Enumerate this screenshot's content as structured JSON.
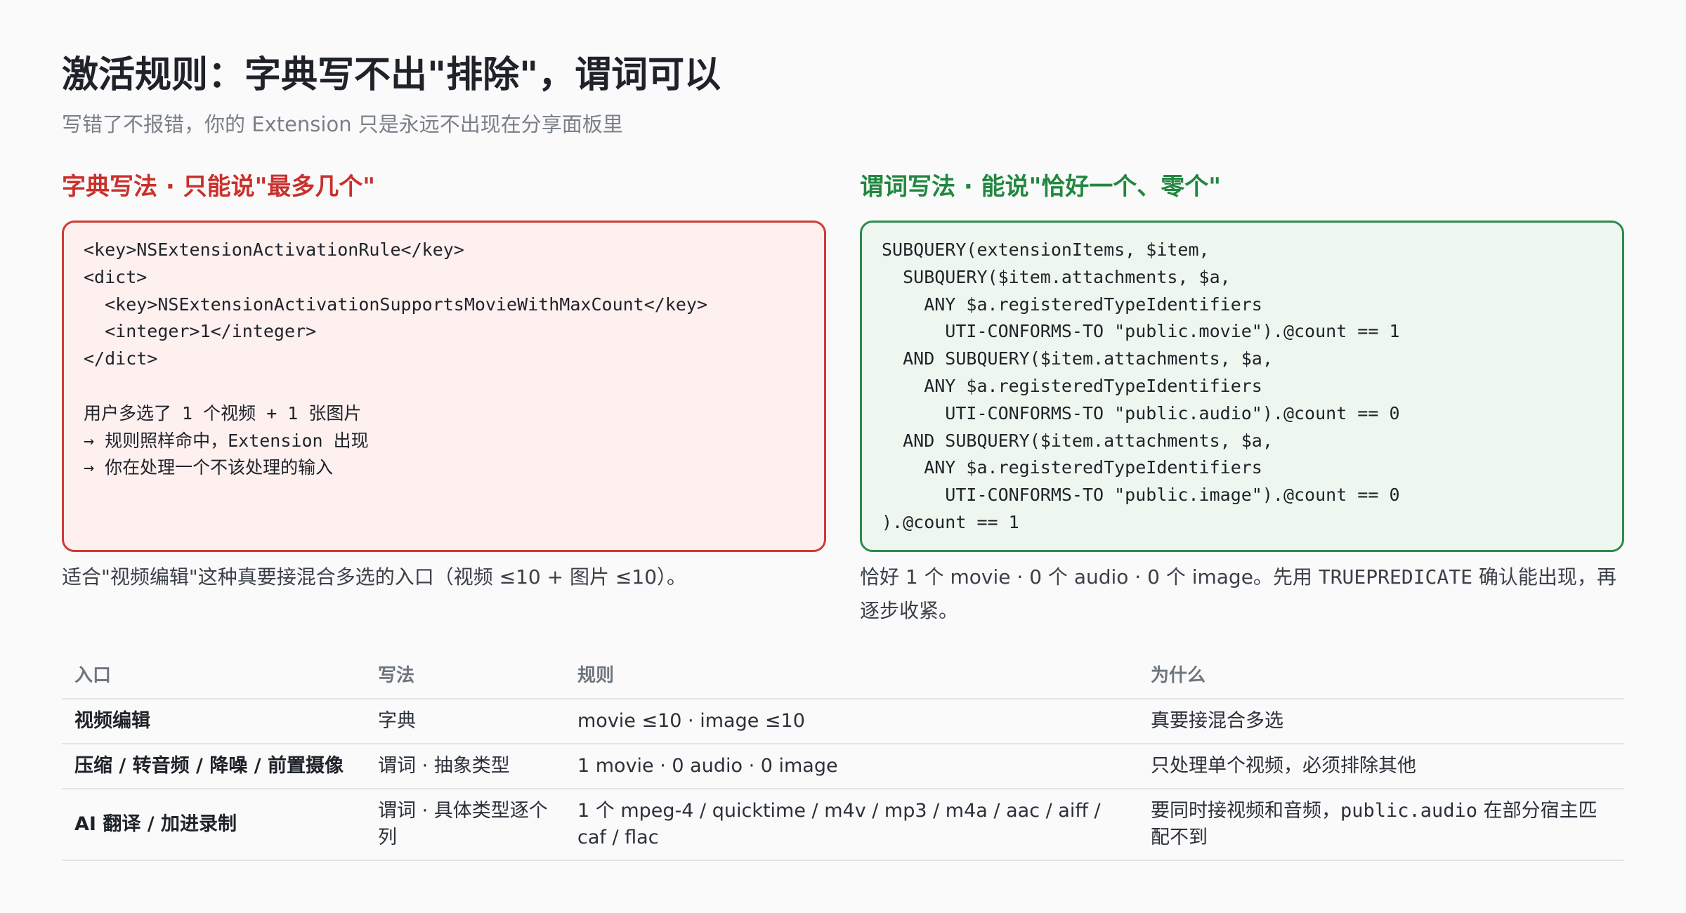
{
  "header": {
    "title": "激活规则：字典写不出\"排除\"，谓词可以",
    "subtitle": "写错了不报错，你的 Extension 只是永远不出现在分享面板里"
  },
  "dict_panel": {
    "heading": "字典写法 · 只能说\"最多几个\"",
    "code_lines": [
      "<key>NSExtensionActivationRule</key>",
      "<dict>",
      "  <key>NSExtensionActivationSupportsMovieWithMaxCount</key>",
      "  <integer>1</integer>",
      "</dict>",
      "",
      "用户多选了 1 个视频 + 1 张图片",
      "→ 规则照样命中，Extension 出现",
      "→ 你在处理一个不该处理的输入"
    ],
    "note": "适合\"视频编辑\"这种真要接混合多选的入口（视频 ≤10 + 图片 ≤10）。"
  },
  "predicate_panel": {
    "heading": "谓词写法 · 能说\"恰好一个、零个\"",
    "code_lines": [
      "SUBQUERY(extensionItems, $item,",
      "  SUBQUERY($item.attachments, $a,",
      "    ANY $a.registeredTypeIdentifiers",
      "      UTI-CONFORMS-TO \"public.movie\").@count == 1",
      "  AND SUBQUERY($item.attachments, $a,",
      "    ANY $a.registeredTypeIdentifiers",
      "      UTI-CONFORMS-TO \"public.audio\").@count == 0",
      "  AND SUBQUERY($item.attachments, $a,",
      "    ANY $a.registeredTypeIdentifiers",
      "      UTI-CONFORMS-TO \"public.image\").@count == 0",
      ").@count == 1"
    ],
    "note_before": "恰好 1 个 movie · 0 个 audio · 0 个 image。先用 ",
    "note_code": "TRUEPREDICATE",
    "note_after": " 确认能出现，再逐步收紧。"
  },
  "table": {
    "headers": [
      "入口",
      "写法",
      "规则",
      "为什么"
    ],
    "rows": [
      {
        "entry": "视频编辑",
        "method": "字典",
        "rule": "movie ≤10 · image ≤10",
        "reason_before": "真要接混合多选"
      },
      {
        "entry": "压缩 / 转音频 / 降噪 / 前置摄像",
        "method": "谓词 · 抽象类型",
        "rule": "1 movie · 0 audio · 0 image",
        "reason_before": "只处理单个视频，必须排除其他"
      },
      {
        "entry": "AI 翻译 / 加进录制",
        "method": "谓词 · 具体类型逐个列",
        "rule": "1 个 mpeg-4 / quicktime / m4v / mp3 / m4a / aac / aiff / caf / flac",
        "reason_before": "要同时接视频和音频，",
        "reason_code": "public.audio",
        "reason_after": " 在部分宿主匹配不到"
      }
    ]
  }
}
